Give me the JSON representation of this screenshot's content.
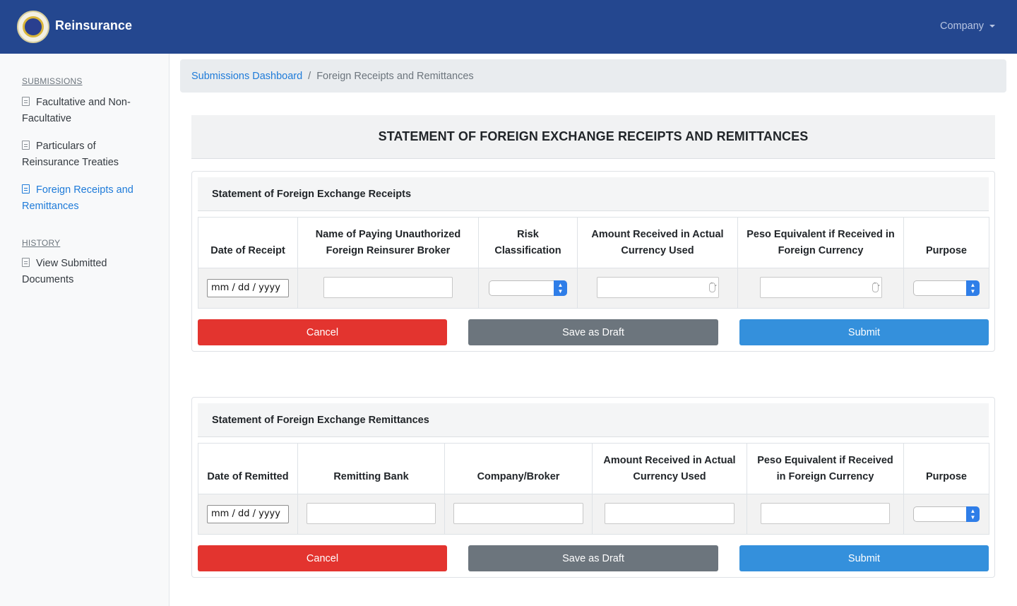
{
  "navbar": {
    "brand": "Reinsurance",
    "company_menu": "Company"
  },
  "sidebar": {
    "submissions_heading": "SUBMISSIONS",
    "submission_items": [
      {
        "label": "Facultative and Non-Facultative"
      },
      {
        "label": "Particulars of Reinsurance Treaties"
      },
      {
        "label": "Foreign Receipts and Remittances"
      }
    ],
    "history_heading": "HISTORY",
    "history_items": [
      {
        "label": "View Submitted Documents"
      }
    ]
  },
  "breadcrumb": {
    "home": "Submissions Dashboard",
    "separator": "/",
    "current": "Foreign Receipts and Remittances"
  },
  "page": {
    "title": "STATEMENT OF FOREIGN EXCHANGE RECEIPTS AND REMITTANCES"
  },
  "receipts": {
    "heading": "Statement of Foreign Exchange Receipts",
    "columns": [
      "Date of Receipt",
      "Name of Paying Unauthorized Foreign Reinsurer Broker",
      "Risk Classification",
      "Amount Received in Actual Currency Used",
      "Peso Equivalent if Received in Foreign Currency",
      "Purpose"
    ],
    "date_placeholder": "mm / dd / yyyy",
    "buttons": {
      "cancel": "Cancel",
      "draft": "Save as Draft",
      "submit": "Submit"
    }
  },
  "remittances": {
    "heading": "Statement of Foreign Exchange Remittances",
    "columns": [
      "Date of Remitted",
      "Remitting Bank",
      "Company/Broker",
      "Amount Received in Actual Currency Used",
      "Peso Equivalent if Received in Foreign Currency",
      "Purpose"
    ],
    "date_placeholder": "mm / dd / yyyy",
    "buttons": {
      "cancel": "Cancel",
      "draft": "Save as Draft",
      "submit": "Submit"
    }
  }
}
